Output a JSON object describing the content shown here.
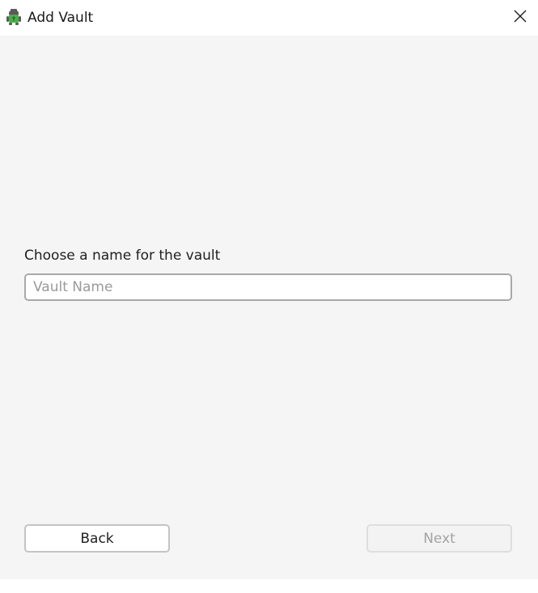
{
  "window": {
    "title": "Add Vault",
    "app_icon": "cryptomator-robot-icon",
    "close_icon": "close-icon"
  },
  "form": {
    "prompt": "Choose a name for the vault",
    "name_input": {
      "value": "",
      "placeholder": "Vault Name"
    }
  },
  "buttons": {
    "back_label": "Back",
    "next_label": "Next",
    "next_enabled": false
  },
  "colors": {
    "content_bg": "#f5f5f5",
    "icon_green": "#49b04a",
    "icon_dark": "#5a5a5a"
  }
}
